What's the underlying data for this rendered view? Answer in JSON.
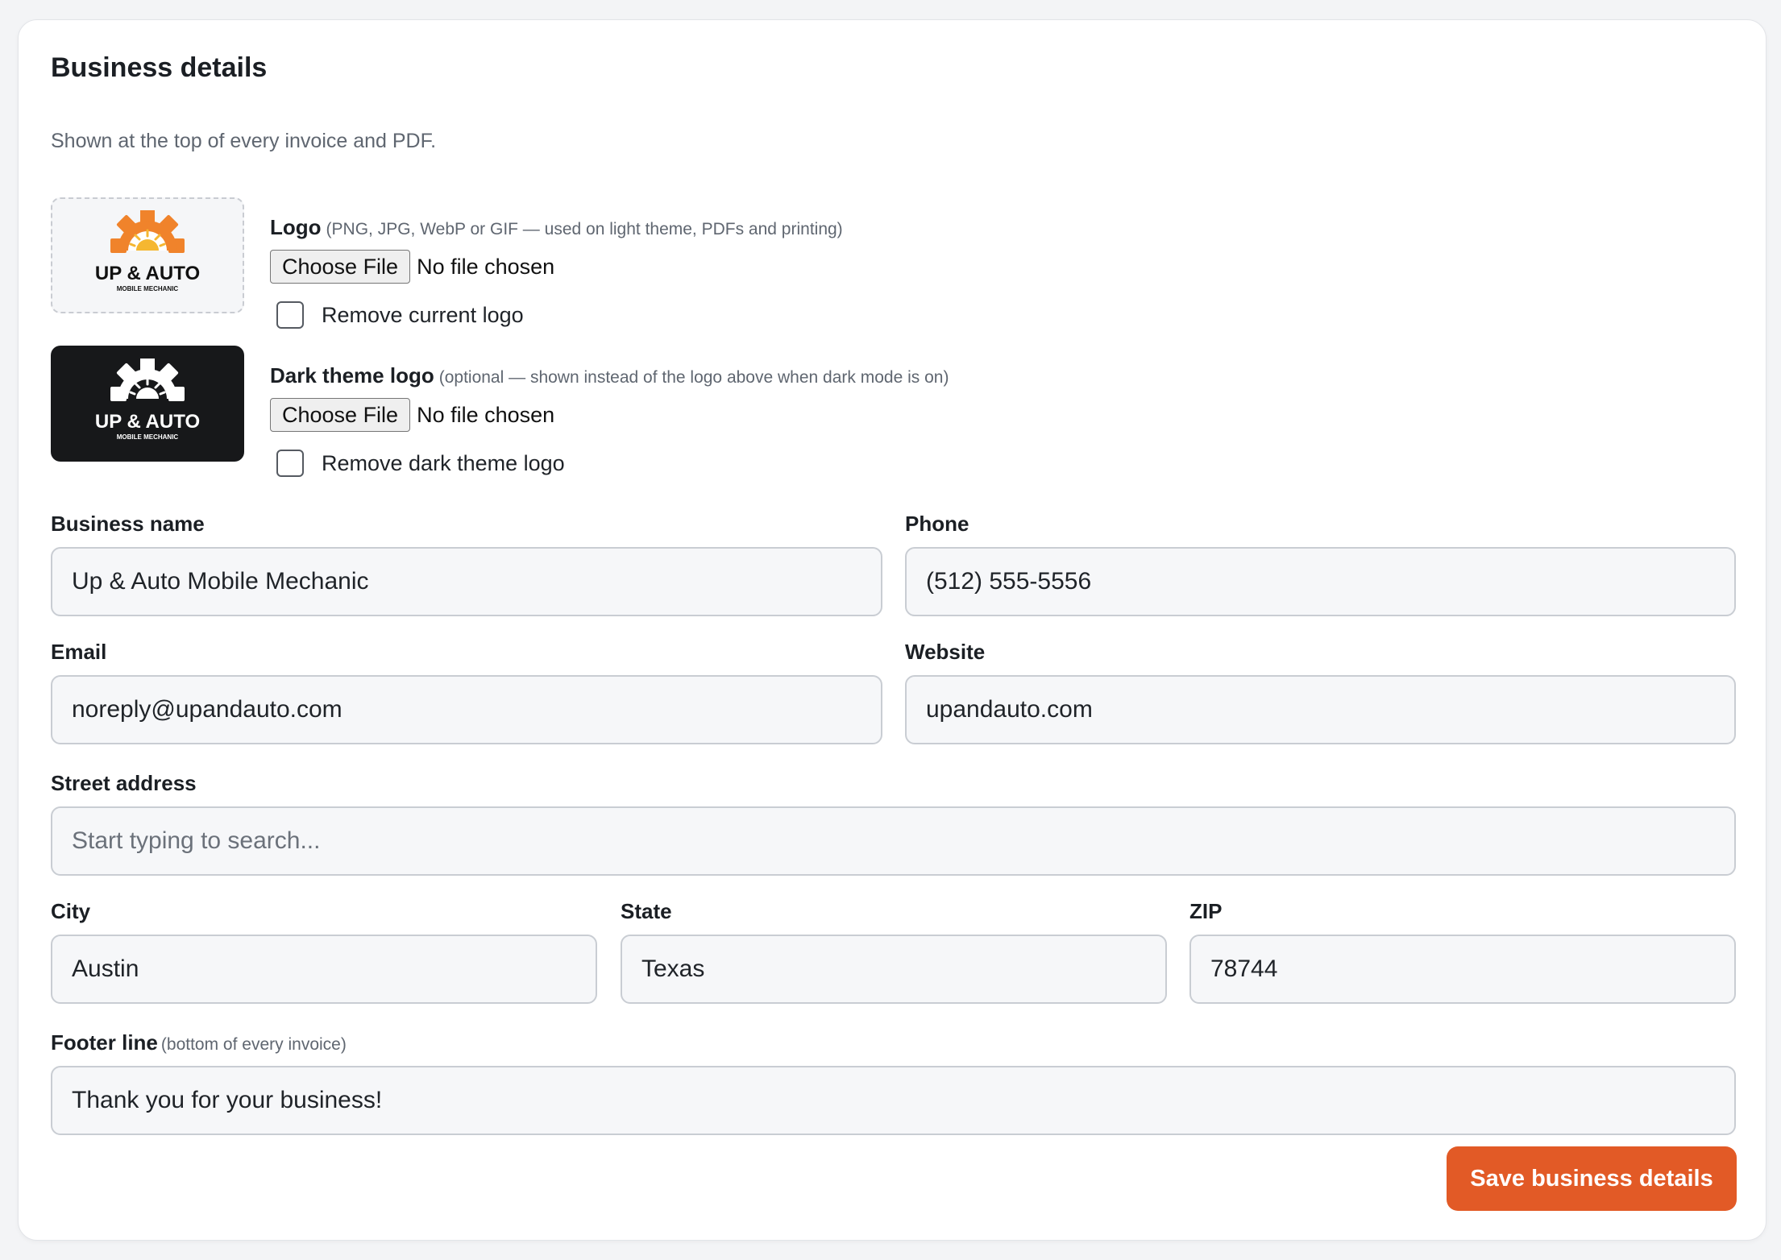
{
  "section": {
    "title": "Business details",
    "subtitle": "Shown at the top of every invoice and PDF."
  },
  "logo_image": {
    "brand_text": "UP & AUTO",
    "tagline": "MOBILE MECHANIC",
    "gear_color": "#f0832b",
    "sun_color": "#f5b731"
  },
  "logo": {
    "label": "Logo",
    "hint": "(PNG, JPG, WebP or GIF — used on light theme, PDFs and printing)",
    "button": "Choose File",
    "status": "No file chosen",
    "remove_label": "Remove current logo"
  },
  "dark_logo": {
    "label": "Dark theme logo",
    "hint": "(optional — shown instead of the logo above when dark mode is on)",
    "button": "Choose File",
    "status": "No file chosen",
    "remove_label": "Remove dark theme logo"
  },
  "fields": {
    "business_name": {
      "label": "Business name",
      "value": "Up & Auto Mobile Mechanic"
    },
    "phone": {
      "label": "Phone",
      "value": "(512) 555-5556"
    },
    "email": {
      "label": "Email",
      "value": "noreply@upandauto.com"
    },
    "website": {
      "label": "Website",
      "value": "upandauto.com"
    },
    "street": {
      "label": "Street address",
      "value": "",
      "placeholder": "Start typing to search..."
    },
    "city": {
      "label": "City",
      "value": "Austin"
    },
    "state": {
      "label": "State",
      "value": "Texas"
    },
    "zip": {
      "label": "ZIP",
      "value": "78744"
    },
    "footer": {
      "label": "Footer line",
      "hint": "(bottom of every invoice)",
      "value": "Thank you for your business!"
    }
  },
  "save_button": "Save business details",
  "colors": {
    "accent": "#e25a26",
    "dark_logo_bg": "#17181a"
  }
}
